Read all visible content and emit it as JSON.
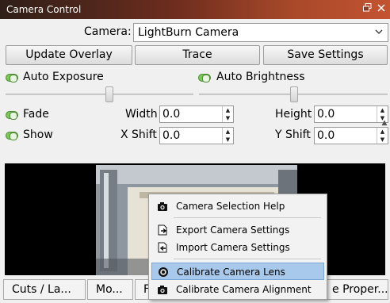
{
  "window": {
    "title": "Camera Control",
    "title_bar_gradient": [
      "#2e1f18",
      "#c35331"
    ]
  },
  "camera": {
    "label": "Camera:",
    "selected": "LightBurn Camera"
  },
  "buttons": {
    "update_overlay": "Update Overlay",
    "trace": "Trace",
    "save_settings": "Save Settings"
  },
  "toggles": {
    "auto_exposure": "Auto Exposure",
    "auto_brightness": "Auto Brightness",
    "fade": "Fade",
    "show": "Show",
    "on_color": "#7cc65a"
  },
  "fields": {
    "width": {
      "label": "Width",
      "value": "0.0"
    },
    "height": {
      "label": "Height",
      "value": "0.0"
    },
    "x_shift": {
      "label": "X Shift",
      "value": "0.0"
    },
    "y_shift": {
      "label": "Y Shift",
      "value": "0.0"
    }
  },
  "tabs": {
    "cuts_layers": "Cuts / La...",
    "move": "Mo...",
    "partial": "F",
    "shape_properties": "e Proper..."
  },
  "context_menu": {
    "items": [
      {
        "label": "Camera Selection Help",
        "icon": "camera-icon"
      },
      {
        "label": "Export Camera Settings",
        "icon": "export-icon"
      },
      {
        "label": "Import Camera Settings",
        "icon": "import-icon"
      },
      {
        "label": "Calibrate Camera Lens",
        "icon": "lens-icon",
        "highlighted": true
      },
      {
        "label": "Calibrate Camera Alignment",
        "icon": "camera-icon"
      }
    ],
    "highlight_color": "#a8c9ec"
  }
}
